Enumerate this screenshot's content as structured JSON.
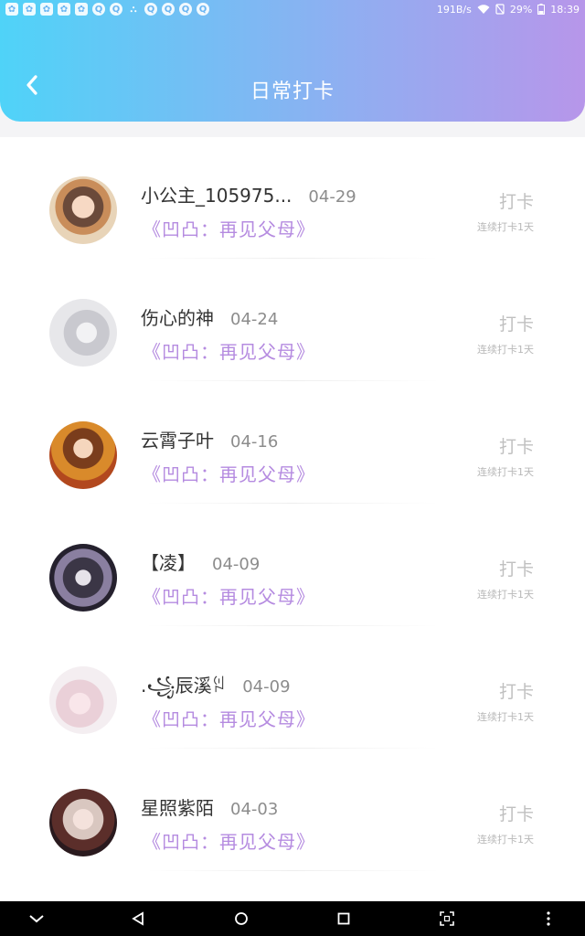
{
  "status_bar": {
    "network_speed": "191B/s",
    "battery": "29%",
    "time": "18:39",
    "notification_icons": [
      "app-icon",
      "app-icon",
      "app-icon",
      "app-icon",
      "app-icon",
      "qq-icon",
      "qq-icon",
      "bag-icon",
      "qq-icon",
      "qq-icon",
      "qq-icon",
      "qq-icon"
    ]
  },
  "header": {
    "title": "日常打卡",
    "back_icon": "chevron-left-icon"
  },
  "list": [
    {
      "name": "小公主_105975...",
      "date": "04-29",
      "book": "《凹凸：再见父母》",
      "action": "打卡",
      "streak": "连续打卡1天"
    },
    {
      "name": "伤心的神",
      "date": "04-24",
      "book": "《凹凸：再见父母》",
      "action": "打卡",
      "streak": "连续打卡1天"
    },
    {
      "name": "云霄子叶",
      "date": "04-16",
      "book": "《凹凸：再见父母》",
      "action": "打卡",
      "streak": "连续打卡1天"
    },
    {
      "name": "【凌】",
      "date": "04-09",
      "book": "《凹凸：再见父母》",
      "action": "打卡",
      "streak": "连续打卡1天"
    },
    {
      "name": ".꧁辰溪ꇌ",
      "date": "04-09",
      "book": "《凹凸：再见父母》",
      "action": "打卡",
      "streak": "连续打卡1天"
    },
    {
      "name": "星照紫陌",
      "date": "04-03",
      "book": "《凹凸：再见父母》",
      "action": "打卡",
      "streak": "连续打卡1天"
    }
  ],
  "colors": {
    "header_gradient_start": "#4fd3f8",
    "header_gradient_end": "#b796ea",
    "book_title": "#b58be0"
  }
}
